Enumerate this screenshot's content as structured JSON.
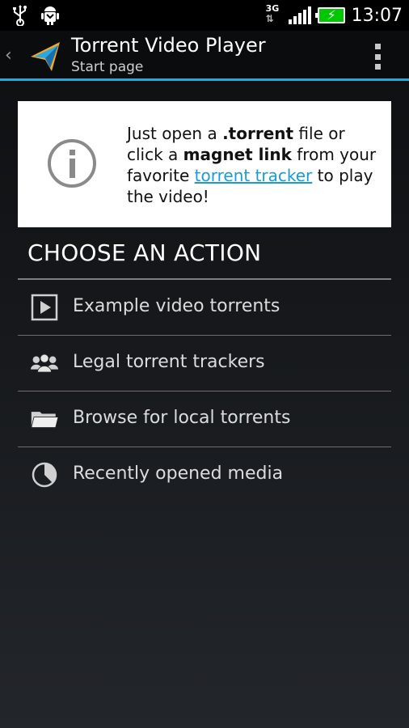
{
  "status_bar": {
    "time": "13:07",
    "network": "3G",
    "icons": [
      "usb-icon",
      "android-debug-icon",
      "network-3g-icon",
      "signal-icon",
      "battery-charging-icon"
    ],
    "battery_color": "#00c800"
  },
  "action_bar": {
    "title": "Torrent Video Player",
    "subtitle": "Start page",
    "accent_color": "#2aa7d8"
  },
  "info_card": {
    "text_part1": "Just open a ",
    "torrent_ext": ".torrent",
    "text_part2": " file or click a ",
    "magnet_link": "magnet link",
    "text_part3": " from your favorite ",
    "tracker_link": "torrent tracker",
    "text_part4": " to play the video!",
    "link_color": "#1a9bd7"
  },
  "section": {
    "title": "CHOOSE AN ACTION"
  },
  "menu": {
    "items": [
      {
        "label": "Example video torrents",
        "icon": "play-icon"
      },
      {
        "label": "Legal torrent trackers",
        "icon": "people-icon"
      },
      {
        "label": "Browse for local torrents",
        "icon": "folder-icon"
      },
      {
        "label": "Recently opened media",
        "icon": "clock-icon"
      }
    ]
  }
}
